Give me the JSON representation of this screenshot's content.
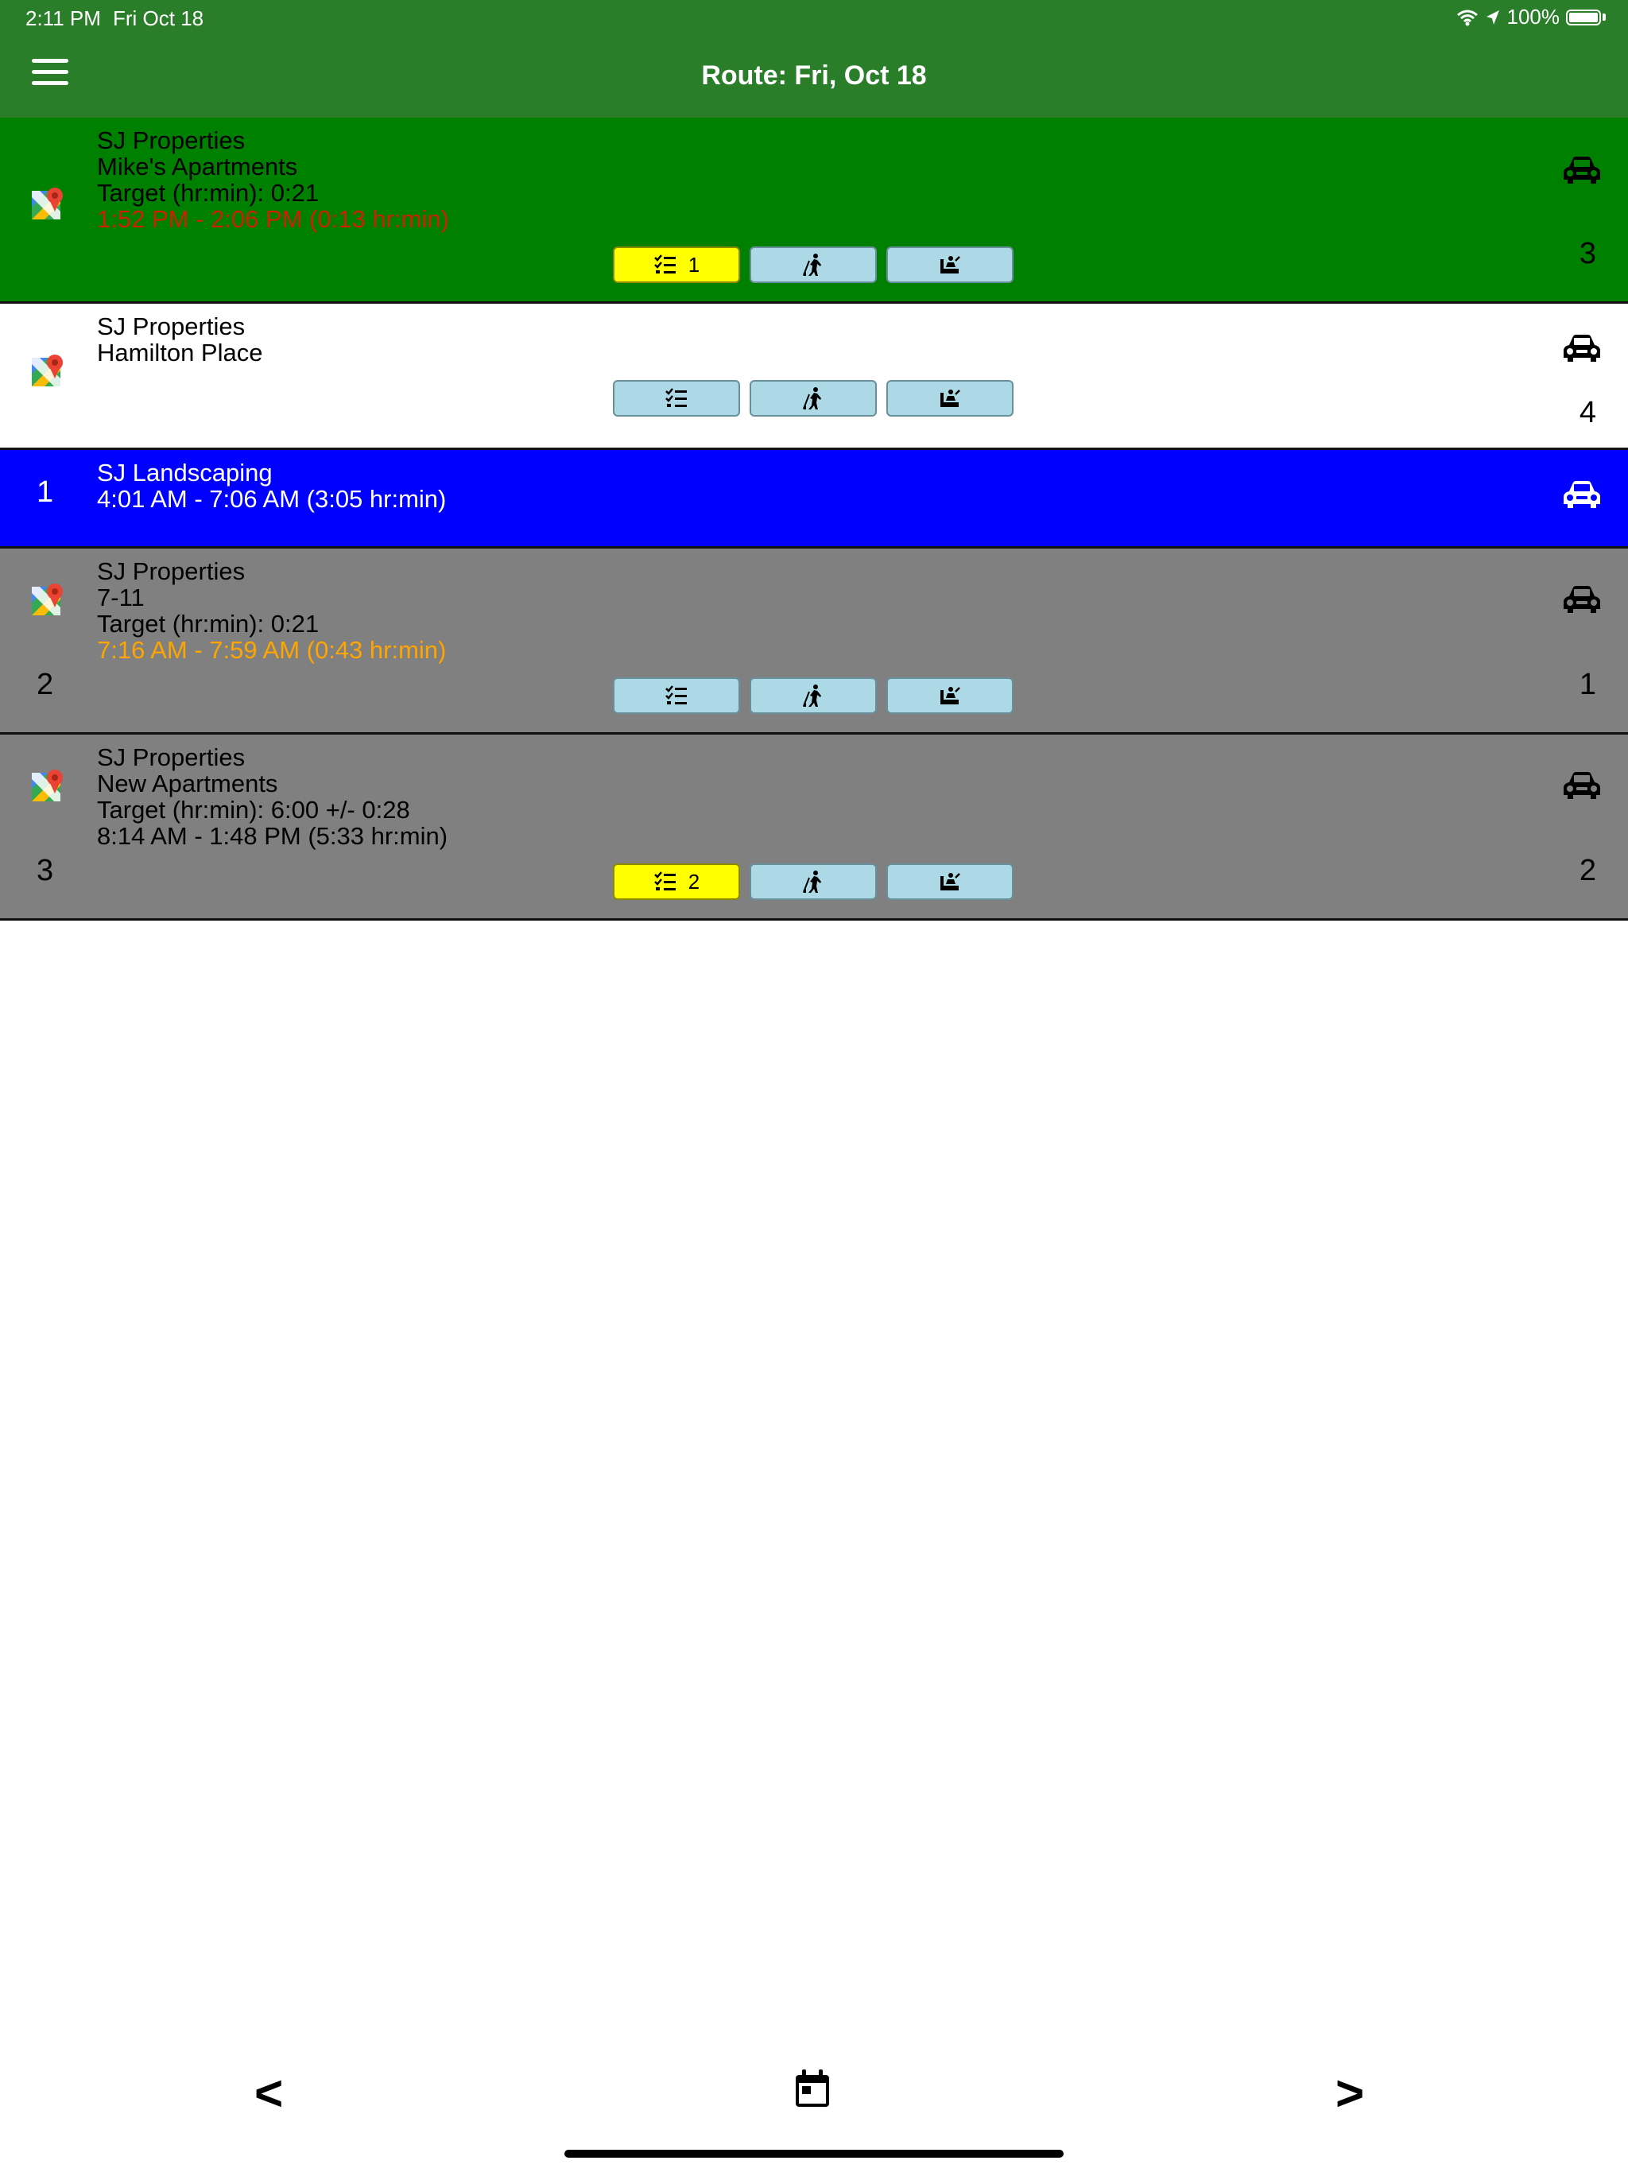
{
  "status": {
    "time": "2:11 PM",
    "date": "Fri Oct 18",
    "battery": "100%"
  },
  "nav": {
    "title": "Route: Fri, Oct 18"
  },
  "colors": {
    "nav_green": "#2a7e2a",
    "row_active": "#008000",
    "row_white": "#ffffff",
    "row_blue": "#0000ff",
    "row_grey": "#808080",
    "time_late": "#cc2200",
    "time_warn": "#ffa500",
    "button_blue": "#add8e6",
    "button_alert": "#ffff00"
  },
  "rows": [
    {
      "company": "SJ Properties",
      "site": "Mike's Apartments",
      "target": "Target (hr:min):  0:21",
      "time": "1:52 PM - 2:06 PM (0:13 hr:min)",
      "order": "3",
      "checklist_count": "1"
    },
    {
      "company": "SJ Properties",
      "site": "Hamilton Place",
      "order": "4"
    },
    {
      "index": "1",
      "company": "SJ Landscaping",
      "time": "4:01 AM - 7:06 AM (3:05 hr:min)"
    },
    {
      "index": "2",
      "company": "SJ Properties",
      "site": "7-11",
      "target": "Target (hr:min):  0:21",
      "time": "7:16 AM - 7:59 AM (0:43 hr:min)",
      "order": "1"
    },
    {
      "index": "3",
      "company": "SJ Properties",
      "site": "New Apartments",
      "target": "Target (hr:min):  6:00 +/- 0:28",
      "time": "8:14 AM - 1:48 PM (5:33 hr:min)",
      "order": "2",
      "checklist_count": "2"
    }
  ],
  "bottom": {
    "prev": "<",
    "next": ">"
  },
  "icons": {
    "menu": "hamburger-icon",
    "map": "google-maps-icon",
    "car": "car-icon",
    "checklist": "checklist-icon",
    "worker": "worker-icon",
    "rest": "rest-icon",
    "calendar": "calendar-icon"
  }
}
